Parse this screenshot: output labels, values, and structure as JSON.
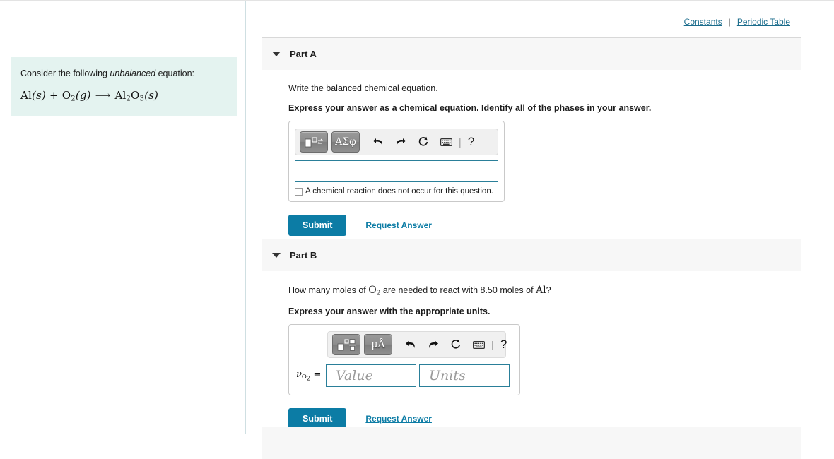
{
  "top_links": {
    "constants": "Constants",
    "separator": "|",
    "periodic_table": "Periodic Table"
  },
  "intro": {
    "lead": "Consider the following ",
    "emphasis": "unbalanced",
    "lead_end": " equation:",
    "equation": {
      "reactant_1": "Al",
      "reactant_1_phase": "(s)",
      "plus": "+",
      "reactant_2": "O",
      "reactant_2_sub": "2",
      "reactant_2_phase": "(g)",
      "arrow": "⟶",
      "product": "Al",
      "product_sub_1": "2",
      "product_el_2": "O",
      "product_sub_2": "3",
      "product_phase": "(s)"
    }
  },
  "parts": [
    {
      "title": "Part A",
      "question": "Write the balanced chemical equation.",
      "instruction": "Express your answer as a chemical equation. Identify all of the phases in your answer.",
      "toolbar": {
        "template_button": "chemical-equation-template",
        "greek_button": "ΑΣφ",
        "undo": "undo-arrow",
        "redo": "redo-arrow",
        "reset": "reset-circle",
        "keyboard": "keyboard-icon",
        "separator": "|",
        "help": "?"
      },
      "input_value": "",
      "checkbox_label": "A chemical reaction does not occur for this question.",
      "checkbox_checked": false,
      "submit_label": "Submit",
      "request_label": "Request Answer"
    },
    {
      "title": "Part B",
      "question_pre": "How many moles of ",
      "question_species": "O",
      "question_species_sub": "2",
      "question_mid": " are needed to react with 8.50 moles of ",
      "question_species2": "Al",
      "question_end": "?",
      "instruction": "Express your answer with the appropriate units.",
      "toolbar": {
        "template_button": "fraction-template",
        "units_button": "μÅ",
        "undo": "undo-arrow",
        "redo": "redo-arrow",
        "reset": "reset-circle",
        "keyboard": "keyboard-icon",
        "separator": "|",
        "help": "?"
      },
      "answer_label_symbol": "ν",
      "answer_label_sub": "O",
      "answer_label_sub2": "2",
      "answer_label_equals": "=",
      "value_placeholder": "Value",
      "units_placeholder": "Units",
      "value_current": "",
      "units_current": "",
      "submit_label": "Submit",
      "request_label": "Request Answer"
    }
  ],
  "colors": {
    "accent": "#0c7ca5",
    "link": "#1b6c8c",
    "intro_background": "#e4f3f0",
    "header_background": "#f7f7f7",
    "input_border": "#2a7f99"
  }
}
